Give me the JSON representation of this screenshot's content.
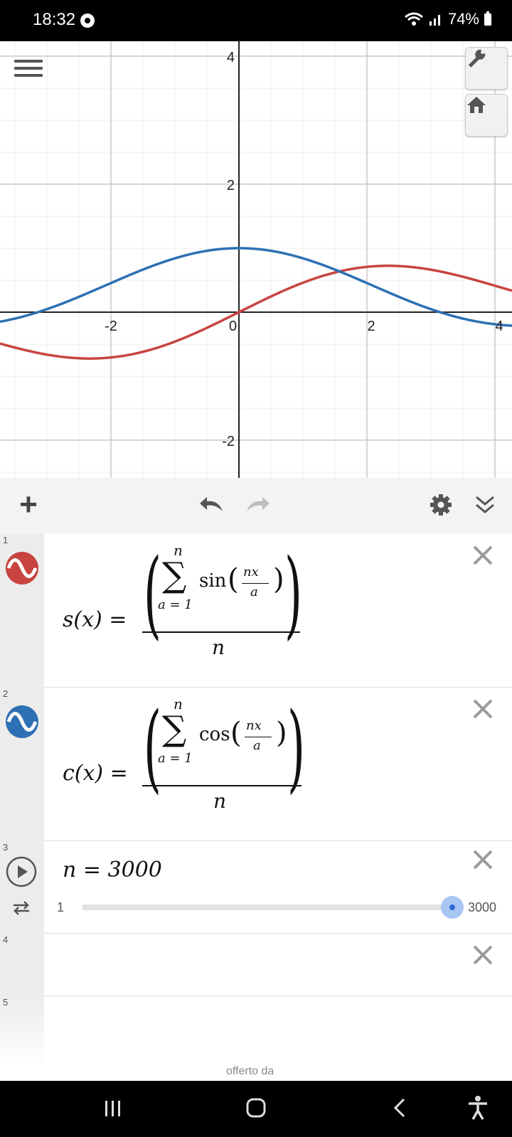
{
  "status": {
    "time": "18:32",
    "battery": "74%"
  },
  "graph": {
    "x_ticks": [
      "-2",
      "0",
      "2",
      "4"
    ],
    "y_ticks": [
      "4",
      "2",
      "-2"
    ],
    "colors": {
      "s_curve": "#c74440",
      "c_curve": "#2d70b3",
      "axis": "#222222",
      "grid_major": "#c8c8c8",
      "grid_minor": "#ececec"
    },
    "icons": {
      "settings": "wrench-icon",
      "home": "home-icon",
      "menu": "hamburger-icon"
    }
  },
  "toolbar": {
    "add": "+",
    "undo": "undo-icon",
    "redo": "redo-icon",
    "settings": "gear-icon",
    "collapse": "double-chevron-down-icon"
  },
  "expressions": [
    {
      "num": "1",
      "lhs": "s(x) =",
      "func": "sin",
      "upper": "n",
      "lower": "a = 1",
      "frac_num": "nx",
      "frac_den": "a",
      "denominator": "n",
      "color": "#c74440"
    },
    {
      "num": "2",
      "lhs": "c(x) =",
      "func": "cos",
      "upper": "n",
      "lower": "a = 1",
      "frac_num": "nx",
      "frac_den": "a",
      "denominator": "n",
      "color": "#2d70b3"
    },
    {
      "num": "3",
      "text": "n = 3000",
      "slider_min": "1",
      "slider_max": "3000",
      "slider_value": 3000
    },
    {
      "num": "4"
    },
    {
      "num": "5"
    }
  ],
  "footer": {
    "offered_by": "offerto da"
  }
}
